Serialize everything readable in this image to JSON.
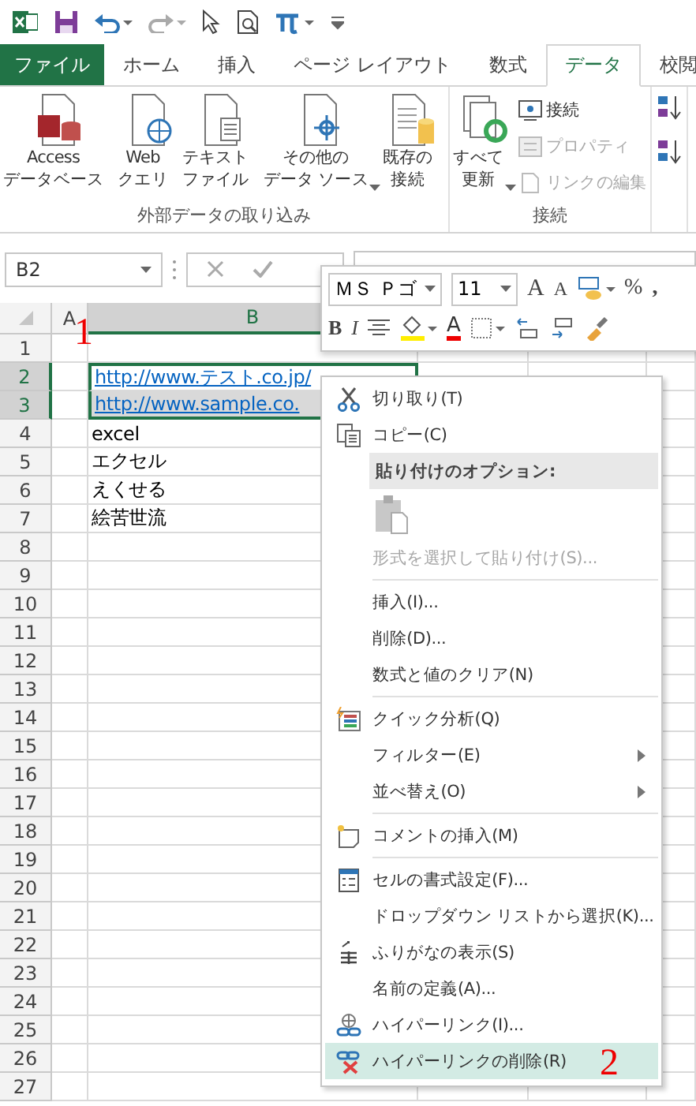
{
  "tabs": [
    {
      "label": "ファイル",
      "kind": "file",
      "selected": false
    },
    {
      "label": "ホーム",
      "kind": "tab",
      "selected": false
    },
    {
      "label": "挿入",
      "kind": "tab",
      "selected": false
    },
    {
      "label": "ページ レイアウト",
      "kind": "tab",
      "selected": false
    },
    {
      "label": "数式",
      "kind": "tab",
      "selected": false
    },
    {
      "label": "データ",
      "kind": "tab",
      "selected": true
    },
    {
      "label": "校閲",
      "kind": "tab",
      "selected": false
    }
  ],
  "ribbon": {
    "groups": [
      {
        "label": "外部データの取り込み",
        "large_buttons": [
          {
            "lines": [
              "Access",
              "データベース"
            ],
            "dropdown": false
          },
          {
            "lines": [
              "Web",
              "クエリ"
            ],
            "dropdown": false
          },
          {
            "lines": [
              "テキスト",
              "ファイル"
            ],
            "dropdown": false
          },
          {
            "lines": [
              "その他の",
              "データ ソース"
            ],
            "dropdown": true
          },
          {
            "lines": [
              "既存の",
              "接続"
            ],
            "dropdown": false
          }
        ]
      },
      {
        "label": "接続",
        "large_buttons": [
          {
            "lines": [
              "すべて",
              "更新"
            ],
            "dropdown": true
          }
        ],
        "small_buttons": [
          {
            "label": "接続",
            "disabled": false
          },
          {
            "label": "プロパティ",
            "disabled": true
          },
          {
            "label": "リンクの編集",
            "disabled": true
          }
        ]
      }
    ]
  },
  "formula_bar": {
    "name_box": "B2"
  },
  "sheet": {
    "columns": [
      {
        "label": "A",
        "selected": false
      },
      {
        "label": "B",
        "selected": true
      }
    ],
    "rows": [
      {
        "header": "1",
        "selected": false
      },
      {
        "header": "2",
        "selected": true,
        "value": "http://www.テスト.co.jp/",
        "kind": "link"
      },
      {
        "header": "3",
        "selected": true,
        "value": "http://www.sample.co.",
        "kind": "link"
      },
      {
        "header": "4",
        "selected": false,
        "value": "excel",
        "kind": "text"
      },
      {
        "header": "5",
        "selected": false,
        "value": "エクセル",
        "kind": "text"
      },
      {
        "header": "6",
        "selected": false,
        "value": "えくせる",
        "kind": "text"
      },
      {
        "header": "7",
        "selected": false,
        "value": "絵苦世流",
        "kind": "text"
      },
      {
        "header": "8",
        "selected": false
      },
      {
        "header": "9",
        "selected": false
      },
      {
        "header": "10",
        "selected": false
      },
      {
        "header": "11",
        "selected": false
      },
      {
        "header": "12",
        "selected": false
      },
      {
        "header": "13",
        "selected": false
      },
      {
        "header": "14",
        "selected": false
      },
      {
        "header": "15",
        "selected": false
      },
      {
        "header": "16",
        "selected": false
      },
      {
        "header": "17",
        "selected": false
      },
      {
        "header": "18",
        "selected": false
      },
      {
        "header": "19",
        "selected": false
      },
      {
        "header": "20",
        "selected": false
      },
      {
        "header": "21",
        "selected": false
      },
      {
        "header": "22",
        "selected": false
      },
      {
        "header": "23",
        "selected": false
      },
      {
        "header": "24",
        "selected": false
      },
      {
        "header": "25",
        "selected": false
      },
      {
        "header": "26",
        "selected": false
      },
      {
        "header": "27",
        "selected": false
      }
    ]
  },
  "mini_toolbar": {
    "font": "ＭＳ Ｐゴ",
    "size": "11",
    "grow": "A",
    "shrink": "A",
    "percent": "%",
    "comma": ",",
    "bold": "B",
    "italic": "I",
    "font_color": "A"
  },
  "context_menu": [
    {
      "kind": "item",
      "label": "切り取り(T)",
      "disabled": false,
      "submenu": false,
      "selected": false
    },
    {
      "kind": "item",
      "label": "コピー(C)",
      "disabled": false,
      "submenu": false,
      "selected": false
    },
    {
      "kind": "header",
      "label": "貼り付けのオプション:"
    },
    {
      "kind": "paste_icons"
    },
    {
      "kind": "item",
      "label": "形式を選択して貼り付け(S)...",
      "disabled": true,
      "submenu": false,
      "selected": false
    },
    {
      "kind": "separator"
    },
    {
      "kind": "item",
      "label": "挿入(I)...",
      "disabled": false,
      "submenu": false,
      "selected": false
    },
    {
      "kind": "item",
      "label": "削除(D)...",
      "disabled": false,
      "submenu": false,
      "selected": false
    },
    {
      "kind": "item",
      "label": "数式と値のクリア(N)",
      "disabled": false,
      "submenu": false,
      "selected": false
    },
    {
      "kind": "separator"
    },
    {
      "kind": "item",
      "label": "クイック分析(Q)",
      "disabled": false,
      "submenu": false,
      "selected": false
    },
    {
      "kind": "item",
      "label": "フィルター(E)",
      "disabled": false,
      "submenu": true,
      "selected": false
    },
    {
      "kind": "item",
      "label": "並べ替え(O)",
      "disabled": false,
      "submenu": true,
      "selected": false
    },
    {
      "kind": "separator"
    },
    {
      "kind": "item",
      "label": "コメントの挿入(M)",
      "disabled": false,
      "submenu": false,
      "selected": false
    },
    {
      "kind": "separator"
    },
    {
      "kind": "item",
      "label": "セルの書式設定(F)...",
      "disabled": false,
      "submenu": false,
      "selected": false
    },
    {
      "kind": "item",
      "label": "ドロップダウン リストから選択(K)...",
      "disabled": false,
      "submenu": false,
      "selected": false
    },
    {
      "kind": "item",
      "label": "ふりがなの表示(S)",
      "disabled": false,
      "submenu": false,
      "selected": false
    },
    {
      "kind": "item",
      "label": "名前の定義(A)...",
      "disabled": false,
      "submenu": false,
      "selected": false
    },
    {
      "kind": "item",
      "label": "ハイパーリンク(I)...",
      "disabled": false,
      "submenu": false,
      "selected": false
    },
    {
      "kind": "item",
      "label": "ハイパーリンクの削除(R)",
      "disabled": false,
      "submenu": false,
      "selected": true
    }
  ],
  "annotations": [
    {
      "text": "1"
    },
    {
      "text": "2"
    }
  ]
}
